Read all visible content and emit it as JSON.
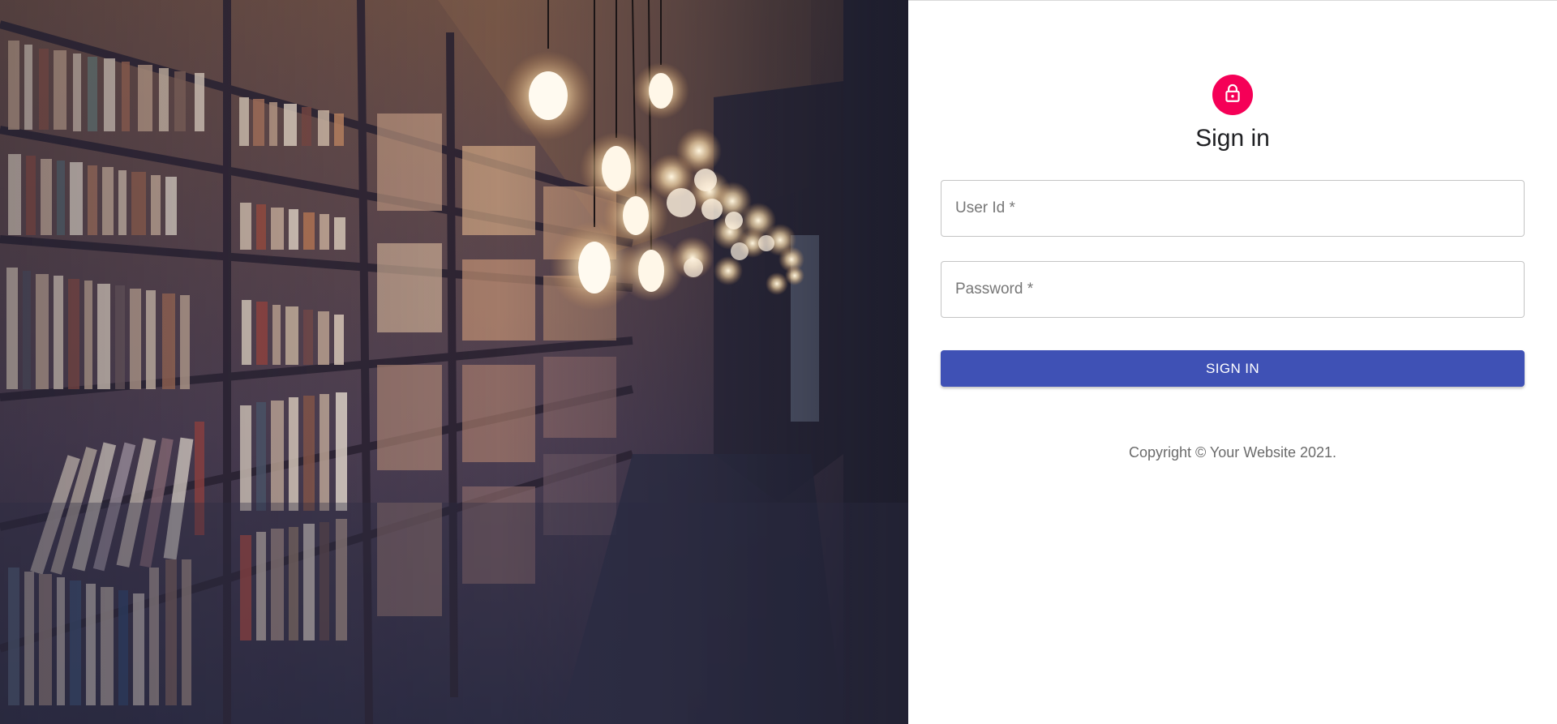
{
  "hero": {
    "image_icon": "library-bookshelf-image"
  },
  "colors": {
    "avatar_bg": "#f50057",
    "primary": "#3f51b5",
    "field_border": "#c4c4c4"
  },
  "form": {
    "icon": "lock-icon",
    "title": "Sign in",
    "user_id_placeholder": "User Id *",
    "password_placeholder": "Password *",
    "submit_label": "SIGN IN"
  },
  "footer": {
    "copyright": "Copyright © Your Website 2021."
  }
}
